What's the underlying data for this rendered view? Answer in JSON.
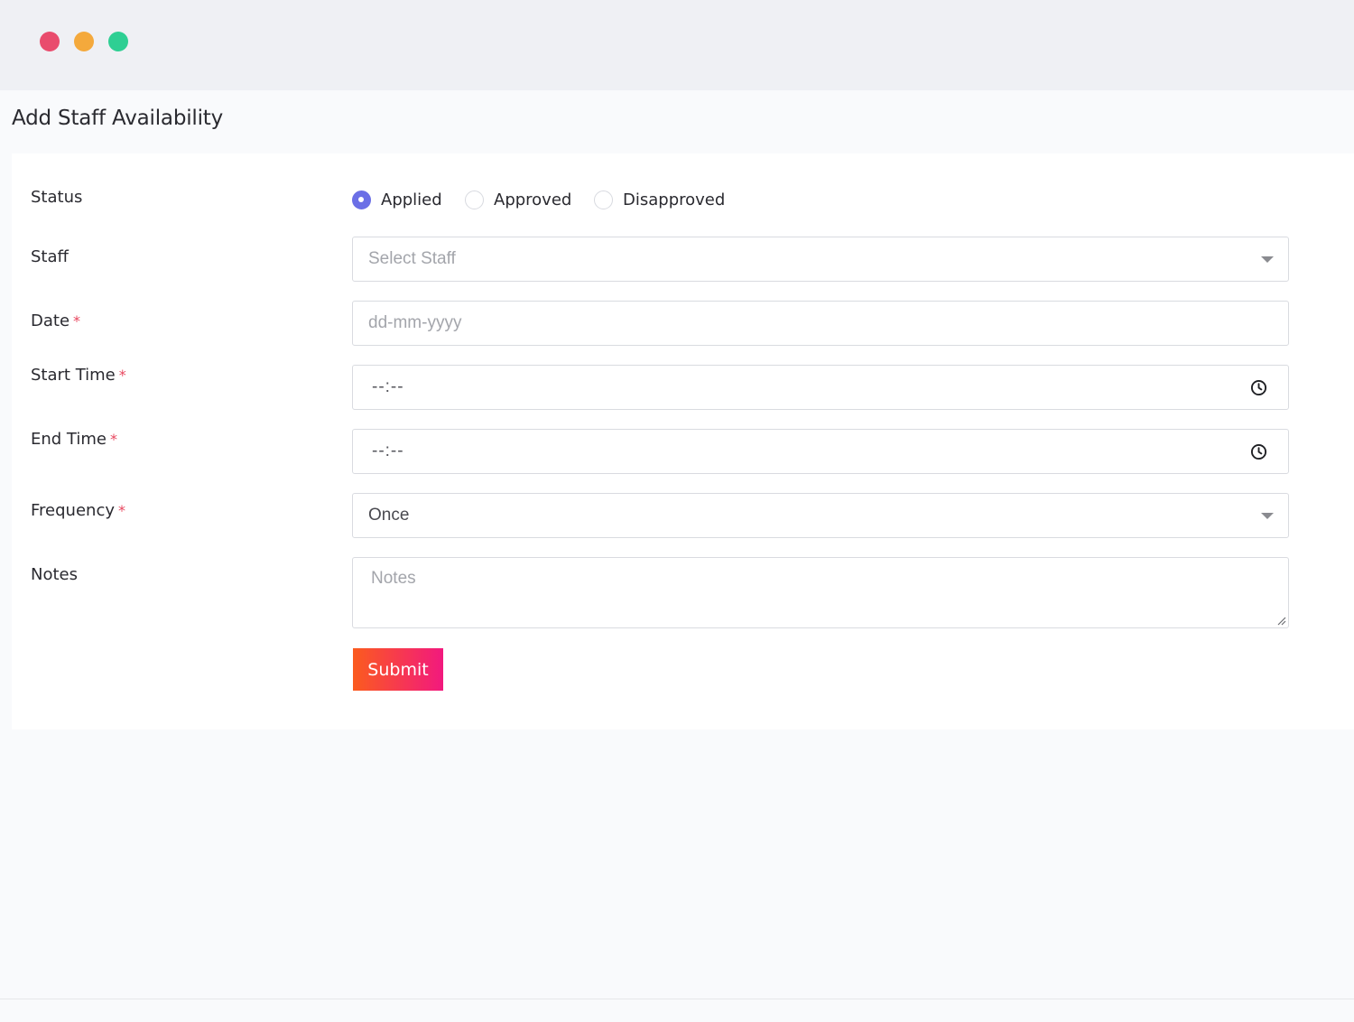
{
  "window": {
    "controls": [
      "close-dot",
      "minimize-dot",
      "maximize-dot"
    ],
    "colors": {
      "close": "#e94c6d",
      "minimize": "#f4a93c",
      "maximize": "#2ecf93"
    }
  },
  "page": {
    "title": "Add Staff Availability"
  },
  "form": {
    "status": {
      "label": "Status",
      "options": [
        "Applied",
        "Approved",
        "Disapproved"
      ],
      "selected": "Applied"
    },
    "staff": {
      "label": "Staff",
      "placeholder": "Select Staff"
    },
    "date": {
      "label": "Date",
      "required_mark": "*",
      "placeholder": "dd-mm-yyyy"
    },
    "start_time": {
      "label": "Start Time",
      "required_mark": "*",
      "value": "--:--",
      "icon": "clock-icon"
    },
    "end_time": {
      "label": "End Time",
      "required_mark": "*",
      "value": "--:--",
      "icon": "clock-icon"
    },
    "frequency": {
      "label": "Frequency",
      "required_mark": "*",
      "value": "Once"
    },
    "notes": {
      "label": "Notes",
      "placeholder": "Notes"
    },
    "submit_label": "Submit"
  },
  "colors": {
    "accent": "#6b6fe6",
    "required": "#e8475f",
    "submit_gradient_start": "#fb5b1e",
    "submit_gradient_end": "#f2197e"
  }
}
